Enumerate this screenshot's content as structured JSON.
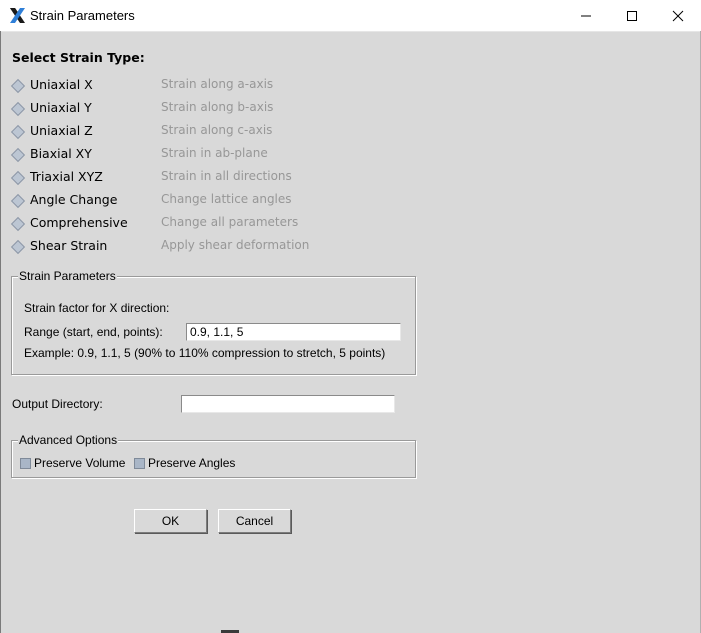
{
  "window": {
    "title": "Strain Parameters",
    "icon": "x-app-icon",
    "controls": [
      "minimize-icon",
      "maximize-icon",
      "close-icon"
    ]
  },
  "strain_type": {
    "heading": "Select Strain Type:",
    "options": [
      {
        "label": "Uniaxial X",
        "description": "Strain along a-axis"
      },
      {
        "label": "Uniaxial Y",
        "description": "Strain along b-axis"
      },
      {
        "label": "Uniaxial Z",
        "description": "Strain along c-axis"
      },
      {
        "label": "Biaxial XY",
        "description": "Strain in ab-plane"
      },
      {
        "label": "Triaxial XYZ",
        "description": "Strain in all directions"
      },
      {
        "label": "Angle Change",
        "description": "Change lattice angles"
      },
      {
        "label": "Comprehensive",
        "description": "Change all parameters"
      },
      {
        "label": "Shear Strain",
        "description": "Apply shear deformation"
      }
    ]
  },
  "strain_parameters": {
    "legend": "Strain Parameters",
    "factor_label": "Strain factor for X direction:",
    "range_label": "Range (start, end, points):",
    "range_value": "0.9, 1.1, 5",
    "example": "Example: 0.9, 1.1, 5 (90% to 110% compression to stretch, 5 points)"
  },
  "output": {
    "label": "Output Directory:",
    "value": ""
  },
  "advanced": {
    "legend": "Advanced Options",
    "preserve_volume": "Preserve Volume",
    "preserve_angles": "Preserve Angles"
  },
  "buttons": {
    "ok": "OK",
    "cancel": "Cancel"
  },
  "colors": {
    "background": "#d9d9d9",
    "disabled_text": "#979797",
    "radio_fill": "#bcc6d3",
    "checkbox_fill": "#a9b6c7"
  }
}
